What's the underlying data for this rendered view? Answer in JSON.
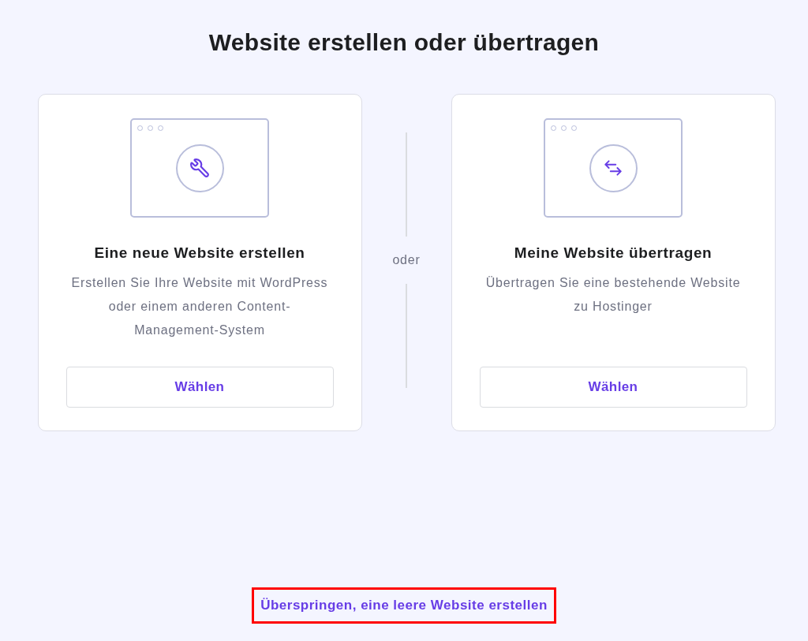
{
  "page": {
    "title": "Website erstellen oder übertragen"
  },
  "options": [
    {
      "kind": "create",
      "title": "Eine neue Website erstellen",
      "description": "Erstellen Sie Ihre Website mit WordPress oder einem anderen Content-Management-System",
      "button": "Wählen"
    },
    {
      "kind": "transfer",
      "title": "Meine Website übertragen",
      "description": "Übertragen Sie eine bestehende Website zu Hostinger",
      "button": "Wählen"
    }
  ],
  "separator": {
    "label": "oder"
  },
  "skip_link": {
    "label": "Überspringen, eine leere Website erstellen",
    "highlighted": true
  }
}
